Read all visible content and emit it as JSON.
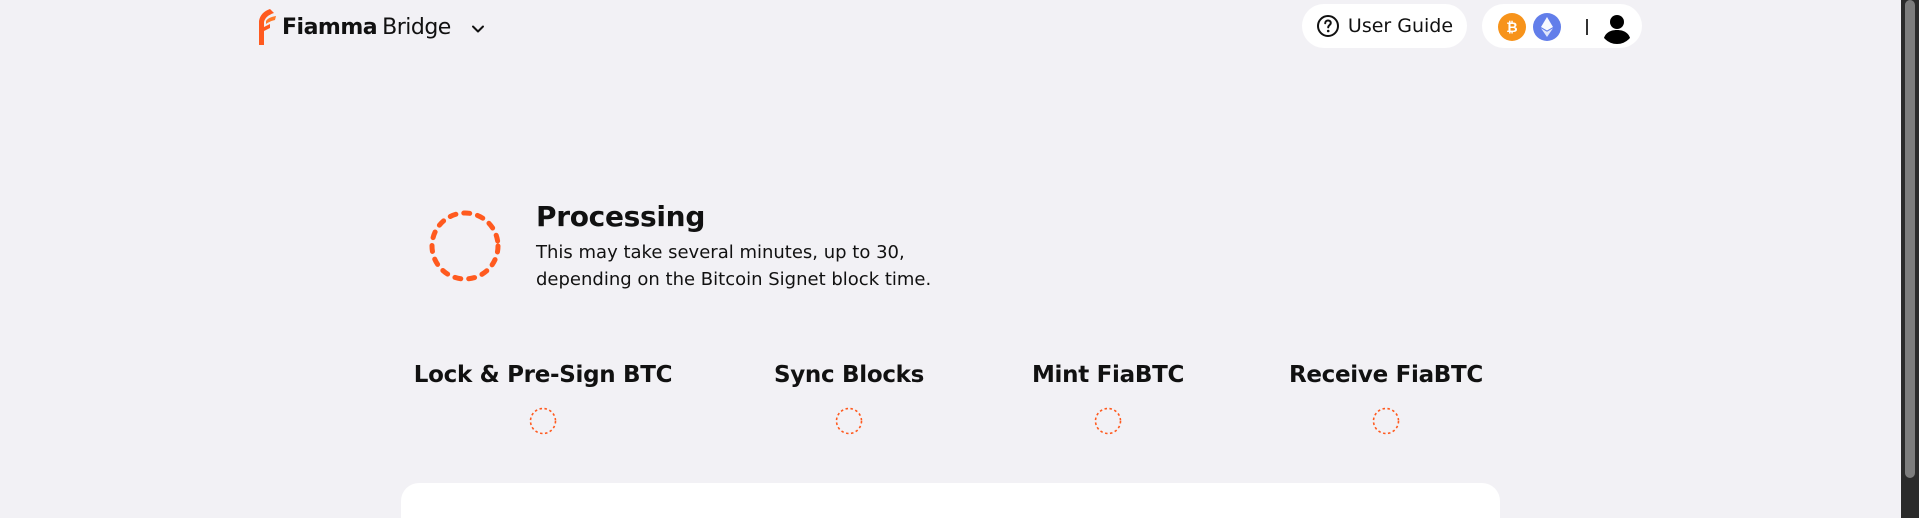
{
  "header": {
    "brand_name": "Fiamma",
    "brand_product": "Bridge",
    "user_guide_label": "User Guide"
  },
  "colors": {
    "accent": "#ff5a1f",
    "btc": "#f7931a",
    "eth": "#627eea",
    "background": "#f2f1f5"
  },
  "icons": {
    "logo": "fiamma-flame-logo",
    "brand_menu": "chevron-down-icon",
    "guide": "question-circle-icon",
    "btc_chain": "bitcoin-icon",
    "eth_chain": "ethereum-icon",
    "user": "user-avatar-icon",
    "progress": "dashed-circle-spinner"
  },
  "processing": {
    "title": "Processing",
    "description_line1": "This may take several minutes, up to 30,",
    "description_line2": "depending on the Bitcoin Signet block time."
  },
  "steps": [
    {
      "label": "Lock & Pre-Sign BTC"
    },
    {
      "label": "Sync Blocks"
    },
    {
      "label": "Mint FiaBTC"
    },
    {
      "label": "Receive FiaBTC"
    }
  ]
}
